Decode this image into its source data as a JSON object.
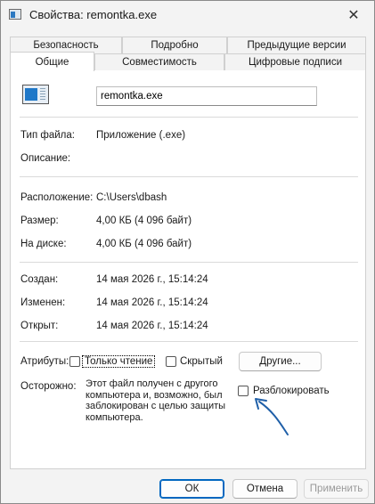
{
  "window": {
    "title": "Свойства: remontka.exe",
    "close_glyph": "✕"
  },
  "tabs_top": [
    "Безопасность",
    "Подробно",
    "Предыдущие версии"
  ],
  "tabs_bottom": [
    "Общие",
    "Совместимость",
    "Цифровые подписи"
  ],
  "active_tab": "Общие",
  "file": {
    "name": "remontka.exe",
    "icon": "exe-file-icon"
  },
  "info": {
    "type_label": "Тип файла:",
    "type_value": "Приложение (.exe)",
    "desc_label": "Описание:",
    "desc_value": "",
    "location_label": "Расположение:",
    "location_value": "C:\\Users\\dbash",
    "size_label": "Размер:",
    "size_value": "4,00 КБ (4 096 байт)",
    "disk_label": "На диске:",
    "disk_value": "4,00 КБ (4 096 байт)",
    "created_label": "Создан:",
    "created_value": "14 мая 2026 г., 15:14:24",
    "modified_label": "Изменен:",
    "modified_value": "14 мая 2026 г., 15:14:24",
    "opened_label": "Открыт:",
    "opened_value": "14 мая 2026 г., 15:14:24"
  },
  "attributes": {
    "label": "Атрибуты:",
    "readonly_label": "Только чтение",
    "readonly_checked": false,
    "hidden_label": "Скрытый",
    "hidden_checked": false,
    "other_button": "Другие..."
  },
  "warning": {
    "label": "Осторожно:",
    "text": "Этот файл получен с другого компьютера и, возможно, был заблокирован с целью защиты компьютера.",
    "unblock_label": "Разблокировать",
    "unblock_checked": false
  },
  "buttons": {
    "ok": "ОК",
    "cancel": "Отмена",
    "apply": "Применить"
  },
  "colors": {
    "accent": "#0067c0",
    "arrow": "#1f5fa8"
  }
}
